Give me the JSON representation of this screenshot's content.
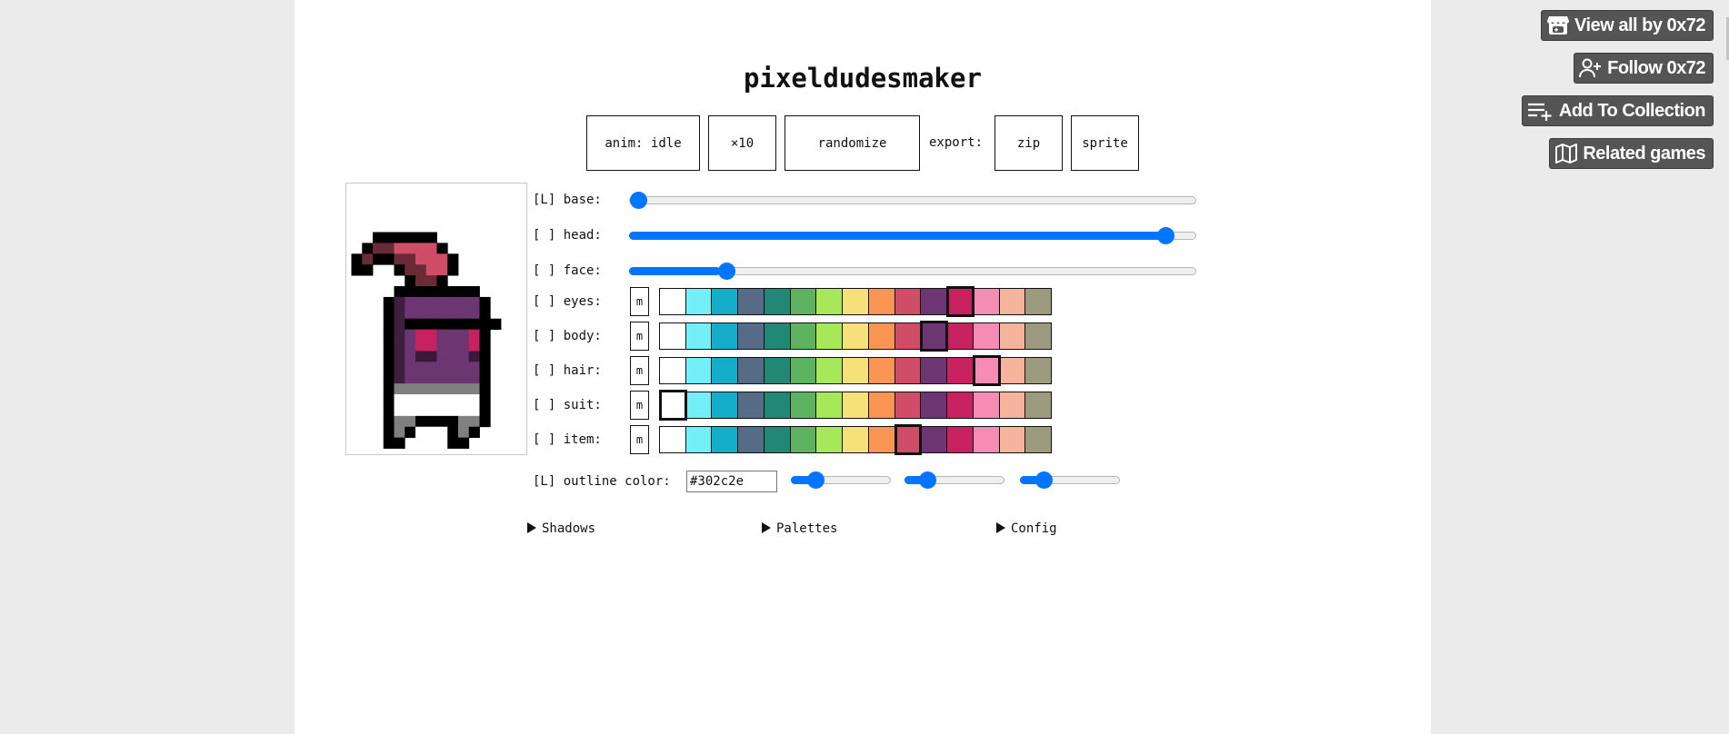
{
  "app": {
    "title": "pixeldudesmaker"
  },
  "toolbar": {
    "anim_label": "anim: idle",
    "scale_label": "×10",
    "randomize_label": "randomize",
    "export_label": "export:",
    "zip_label": "zip",
    "sprite_label": "sprite"
  },
  "palette": [
    "#ffffff",
    "#73eff7",
    "#14aeca",
    "#566c86",
    "#208874",
    "#5db360",
    "#a7e85a",
    "#f5e07a",
    "#fb9554",
    "#cf4d66",
    "#6b3672",
    "#c7225f",
    "#f58cb4",
    "#f7b49c",
    "#9c9a7f"
  ],
  "sliders": [
    {
      "key": "base",
      "label": "[L] base:",
      "value": 0.0
    },
    {
      "key": "head",
      "label": "[ ] head:",
      "value": 0.96
    },
    {
      "key": "face",
      "label": "[ ] face:",
      "value": 0.16
    }
  ],
  "color_rows": [
    {
      "key": "eyes",
      "label": "[ ] eyes:",
      "m_label": "m",
      "selected": 11
    },
    {
      "key": "body",
      "label": "[ ] body:",
      "m_label": "m",
      "selected": 10
    },
    {
      "key": "hair",
      "label": "[ ] hair:",
      "m_label": "m",
      "selected": 12
    },
    {
      "key": "suit",
      "label": "[ ] suit:",
      "m_label": "m",
      "selected": 0
    },
    {
      "key": "item",
      "label": "[ ] item:",
      "m_label": "m",
      "selected": 9
    }
  ],
  "outline": {
    "label": "[L] outline color:",
    "value": "#302c2e",
    "rgb_sliders": [
      0.19,
      0.17,
      0.18
    ]
  },
  "sections": [
    {
      "label": "Shadows"
    },
    {
      "label": "Palettes"
    },
    {
      "label": "Config"
    }
  ],
  "sprite": {
    "colors": {
      "K": "#000000",
      "R": "#6b2a38",
      "P": "#cf4d66",
      "D": "#3e1f40",
      "V": "#6b3672",
      "M": "#c7225f",
      "E": "#3a1a3a",
      "G": "#808080",
      "W": "#ffffff"
    },
    "rows": [
      "..KKKKKK......",
      ".KRRPPPPK.....",
      "KRKKRRPPPK....",
      "KK..KRRPPK....",
      ".....KRRK.....",
      "....KKKKKKKK..",
      "...KDVVVVVVVK.",
      "...KDVVVVVVVK.",
      "...KDKKKKKKKKK",
      "...KDVMMVVVMK.",
      "...KDVMMVVVMK.",
      "...KDVEEVVVEK.",
      "...KDVVVVVVVK.",
      "...KDVVVVVVVK.",
      "...KGGGGGGGGK.",
      "...KWWWWWWWWK.",
      "...KWWWWWWWWK.",
      "...KGGKKKKGGK.",
      "...KGKWWWKGK..",
      "...KK....KK..."
    ]
  },
  "itch_buttons": [
    {
      "label": "View all by 0x72",
      "icon": "itch-store-icon"
    },
    {
      "label": "Follow 0x72",
      "icon": "follow-user-icon"
    },
    {
      "label": "Add To Collection",
      "icon": "add-collection-icon"
    },
    {
      "label": "Related games",
      "icon": "map-icon"
    }
  ]
}
